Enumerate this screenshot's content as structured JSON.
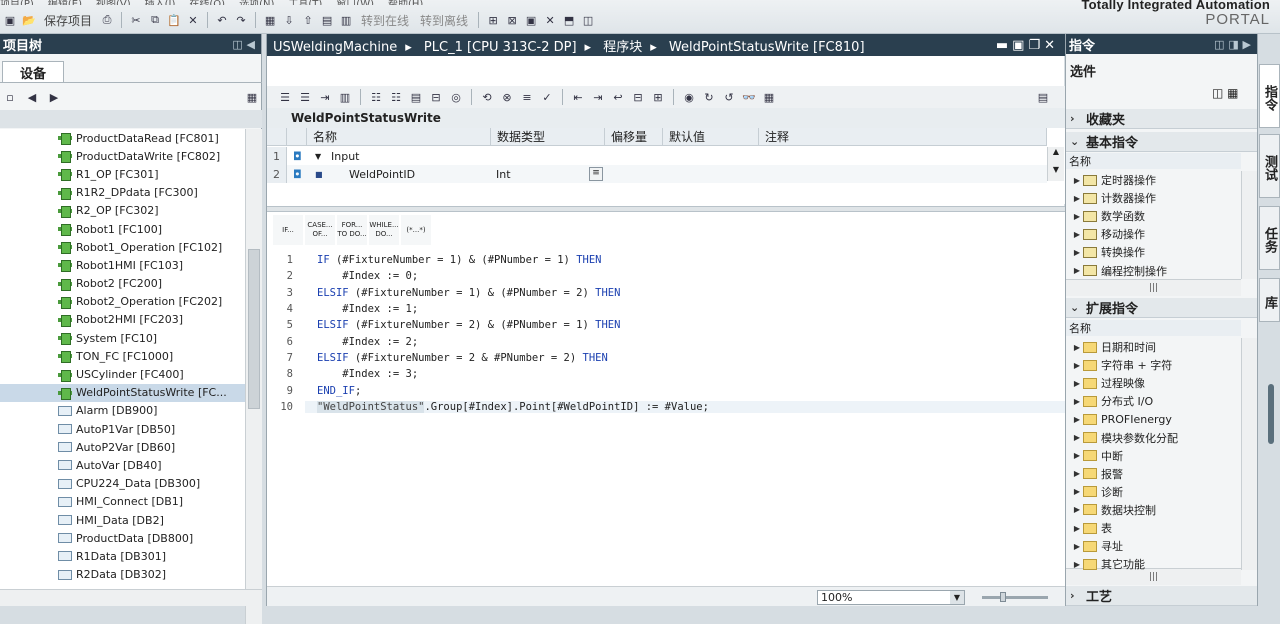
{
  "menu": [
    "项目(P)",
    "编辑(E)",
    "视图(V)",
    "插入(I)",
    "在线(O)",
    "选项(N)",
    "工具(T)",
    "窗口(W)",
    "帮助(H)"
  ],
  "toolbar": {
    "save_project": "保存项目",
    "go_online": "转到在线",
    "go_offline": "转到离线"
  },
  "brand": {
    "line1": "Totally Integrated Automation",
    "line2": "PORTAL"
  },
  "project_tree": {
    "title": "项目树",
    "devices_tab": "设备",
    "items": [
      {
        "label": "ProductDataRead [FC801]",
        "type": "fc"
      },
      {
        "label": "ProductDataWrite [FC802]",
        "type": "fc"
      },
      {
        "label": "R1_OP [FC301]",
        "type": "fc"
      },
      {
        "label": "R1R2_DPdata [FC300]",
        "type": "fc"
      },
      {
        "label": "R2_OP [FC302]",
        "type": "fc"
      },
      {
        "label": "Robot1 [FC100]",
        "type": "fc"
      },
      {
        "label": "Robot1_Operation [FC102]",
        "type": "fc"
      },
      {
        "label": "Robot1HMI [FC103]",
        "type": "fc"
      },
      {
        "label": "Robot2 [FC200]",
        "type": "fc"
      },
      {
        "label": "Robot2_Operation [FC202]",
        "type": "fc"
      },
      {
        "label": "Robot2HMI [FC203]",
        "type": "fc"
      },
      {
        "label": "System [FC10]",
        "type": "fc"
      },
      {
        "label": "TON_FC [FC1000]",
        "type": "fc"
      },
      {
        "label": "USCylinder [FC400]",
        "type": "fc"
      },
      {
        "label": "WeldPointStatusWrite [FC...",
        "type": "fc",
        "selected": true
      },
      {
        "label": "Alarm [DB900]",
        "type": "db"
      },
      {
        "label": "AutoP1Var [DB50]",
        "type": "db"
      },
      {
        "label": "AutoP2Var [DB60]",
        "type": "db"
      },
      {
        "label": "AutoVar [DB40]",
        "type": "db"
      },
      {
        "label": "CPU224_Data [DB300]",
        "type": "db"
      },
      {
        "label": "HMI_Connect [DB1]",
        "type": "db"
      },
      {
        "label": "HMI_Data [DB2]",
        "type": "db"
      },
      {
        "label": "ProductData [DB800]",
        "type": "db"
      },
      {
        "label": "R1Data [DB301]",
        "type": "db"
      },
      {
        "label": "R2Data [DB302]",
        "type": "db"
      }
    ]
  },
  "editor": {
    "breadcrumb": [
      "USWeldingMachine",
      "PLC_1 [CPU 313C-2 DP]",
      "程序块",
      "WeldPointStatusWrite [FC810]"
    ],
    "block_name": "WeldPointStatusWrite",
    "columns": [
      "名称",
      "数据类型",
      "偏移量",
      "默认值",
      "注释"
    ],
    "interface_rows": [
      {
        "num": "1",
        "name": "Input",
        "type": ""
      },
      {
        "num": "2",
        "name": "WeldPointID",
        "type": "Int"
      }
    ],
    "keyword_buttons": [
      "IF...",
      "CASE... OF...",
      "FOR... TO DO...",
      "WHILE... DO...",
      "(*...*)"
    ],
    "code_lines": [
      {
        "n": "1",
        "text": "IF (#FixtureNumber = 1) & (#PNumber = 1) THEN"
      },
      {
        "n": "2",
        "text": "    #Index := 0;"
      },
      {
        "n": "3",
        "text": "ELSIF (#FixtureNumber = 1) & (#PNumber = 2) THEN"
      },
      {
        "n": "4",
        "text": "    #Index := 1;"
      },
      {
        "n": "5",
        "text": "ELSIF (#FixtureNumber = 2) & (#PNumber = 1) THEN"
      },
      {
        "n": "6",
        "text": "    #Index := 2;"
      },
      {
        "n": "7",
        "text": "ELSIF (#FixtureNumber = 2 & #PNumber = 2) THEN"
      },
      {
        "n": "8",
        "text": "    #Index := 3;"
      },
      {
        "n": "9",
        "text": "END_IF;"
      },
      {
        "n": "10",
        "text": "\"WeldPointStatus\".Group[#Index].Point[#WeldPointID] := #Value;"
      }
    ],
    "zoom": "100%"
  },
  "instructions": {
    "title": "指令",
    "options": "选件",
    "favorites": "收藏夹",
    "basic": "基本指令",
    "name_col": "名称",
    "basic_items": [
      "定时器操作",
      "计数器操作",
      "数学函数",
      "移动操作",
      "转换操作",
      "编程控制操作"
    ],
    "extended": "扩展指令",
    "extended_items": [
      "日期和时间",
      "字符串 + 字符",
      "过程映像",
      "分布式 I/O",
      "PROFIenergy",
      "模块参数化分配",
      "中断",
      "报警",
      "诊断",
      "数据块控制",
      "表",
      "寻址",
      "其它功能"
    ],
    "tech": "工艺"
  },
  "side_tabs": [
    "指令",
    "测试",
    "任务",
    "库"
  ]
}
